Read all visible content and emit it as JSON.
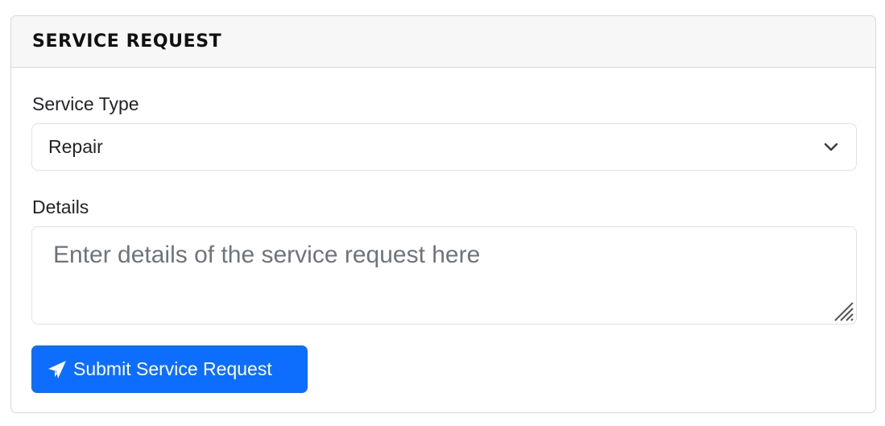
{
  "card": {
    "title": "SERVICE REQUEST"
  },
  "service_type": {
    "label": "Service Type",
    "selected_value": "Repair"
  },
  "details": {
    "label": "Details",
    "placeholder": "Enter details of the service request here"
  },
  "submit": {
    "label": "Submit Service Request",
    "icon": "paper-plane-icon"
  },
  "colors": {
    "primary": "#0d6efd",
    "header_bg": "#f7f7f7",
    "border": "#dee2e6",
    "placeholder": "#6c757d"
  }
}
